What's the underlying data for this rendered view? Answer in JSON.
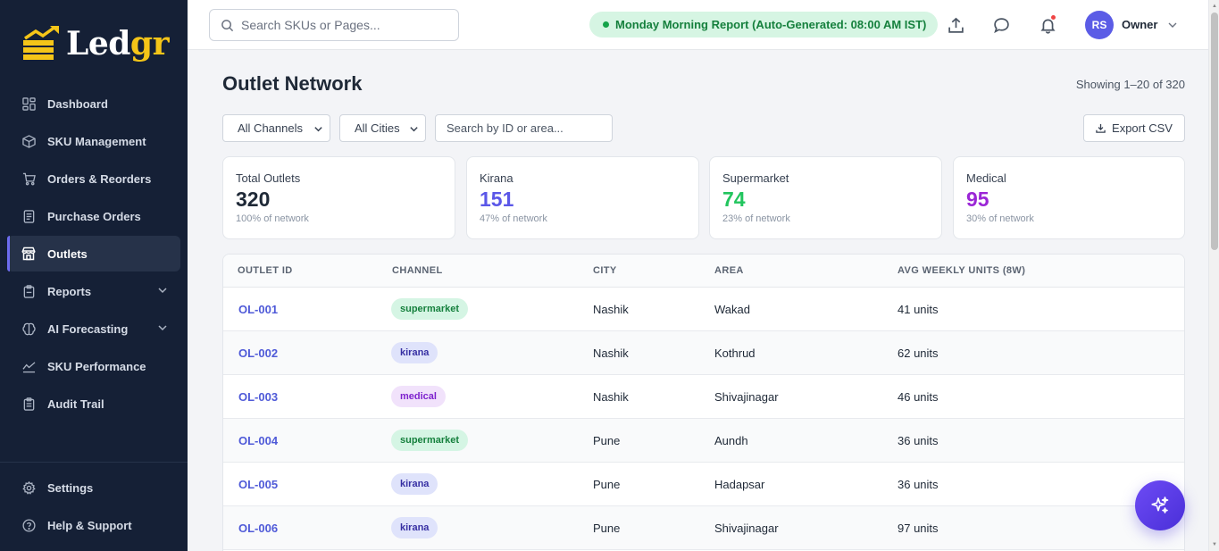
{
  "brand": {
    "name_part1": "Led",
    "name_part2": "gr"
  },
  "sidebar": {
    "items": [
      {
        "label": "Dashboard",
        "icon": "dashboard-icon"
      },
      {
        "label": "SKU Management",
        "icon": "box-icon"
      },
      {
        "label": "Orders & Reorders",
        "icon": "cart-icon"
      },
      {
        "label": "Purchase Orders",
        "icon": "document-icon"
      },
      {
        "label": "Outlets",
        "icon": "store-icon",
        "active": true
      },
      {
        "label": "Reports",
        "icon": "clipboard-icon",
        "expandable": true
      },
      {
        "label": "AI Forecasting",
        "icon": "brain-icon",
        "expandable": true
      },
      {
        "label": "SKU Performance",
        "icon": "chart-icon"
      },
      {
        "label": "Audit Trail",
        "icon": "clipboard-list-icon"
      }
    ],
    "bottom": [
      {
        "label": "Settings",
        "icon": "gear-icon"
      },
      {
        "label": "Help & Support",
        "icon": "help-icon"
      }
    ]
  },
  "topbar": {
    "search_placeholder": "Search SKUs or Pages...",
    "report_text": "Monday Morning Report (Auto-Generated: 08:00 AM IST)",
    "user_initials": "RS",
    "user_role": "Owner"
  },
  "page": {
    "title": "Outlet Network",
    "showing": "Showing 1–20 of 320",
    "filter_channel": "All Channels",
    "filter_city": "All Cities",
    "search_placeholder": "Search by ID or area...",
    "export_label": "Export CSV"
  },
  "stats": [
    {
      "label": "Total Outlets",
      "value": "320",
      "sub": "100% of network",
      "color": "#1f2937"
    },
    {
      "label": "Kirana",
      "value": "151",
      "sub": "47% of network",
      "color": "#5b57e8"
    },
    {
      "label": "Supermarket",
      "value": "74",
      "sub": "23% of network",
      "color": "#22c55e"
    },
    {
      "label": "Medical",
      "value": "95",
      "sub": "30% of network",
      "color": "#9b26d6"
    }
  ],
  "table": {
    "headers": [
      "OUTLET ID",
      "CHANNEL",
      "CITY",
      "AREA",
      "AVG WEEKLY UNITS (8W)"
    ],
    "rows": [
      {
        "id": "OL-001",
        "channel": "supermarket",
        "city": "Nashik",
        "area": "Wakad",
        "units": "41 units"
      },
      {
        "id": "OL-002",
        "channel": "kirana",
        "city": "Nashik",
        "area": "Kothrud",
        "units": "62 units"
      },
      {
        "id": "OL-003",
        "channel": "medical",
        "city": "Nashik",
        "area": "Shivajinagar",
        "units": "46 units"
      },
      {
        "id": "OL-004",
        "channel": "supermarket",
        "city": "Pune",
        "area": "Aundh",
        "units": "36 units"
      },
      {
        "id": "OL-005",
        "channel": "kirana",
        "city": "Pune",
        "area": "Hadapsar",
        "units": "36 units"
      },
      {
        "id": "OL-006",
        "channel": "kirana",
        "city": "Pune",
        "area": "Shivajinagar",
        "units": "97 units"
      }
    ]
  },
  "colors": {
    "accent": "#5b5ce6",
    "sidebar_bg": "#152036",
    "logo_gold": "#f5c518"
  }
}
